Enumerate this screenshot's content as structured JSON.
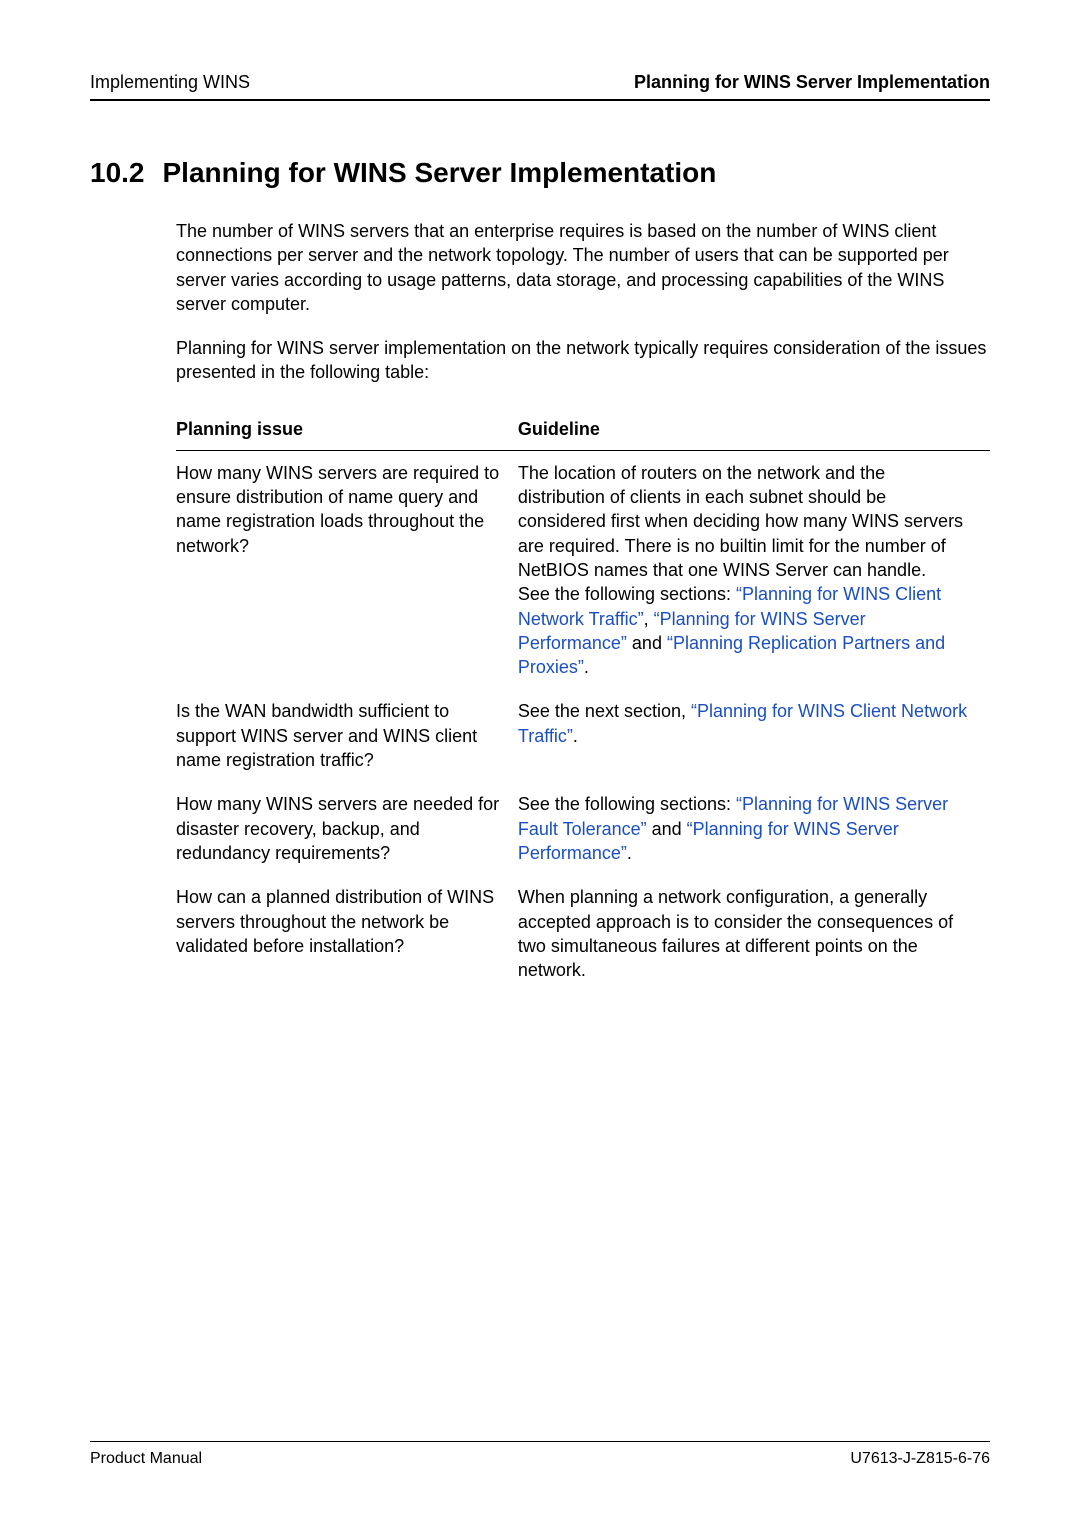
{
  "header": {
    "left": "Implementing WINS",
    "right": "Planning for WINS Server Implementation"
  },
  "section": {
    "number": "10.2",
    "title": "Planning for WINS Server Implementation"
  },
  "paragraphs": {
    "p1": "The number of WINS servers that an enterprise requires is based on the number of WINS client connections per server and the network topology. The number of users that can be supported per server varies according to usage patterns, data storage, and processing capabilities of the WINS server computer.",
    "p2": "Planning for WINS server implementation on the network typically requires consideration of the issues presented in the following table:"
  },
  "table": {
    "head_issue": "Planning issue",
    "head_guideline": "Guideline",
    "rows": [
      {
        "issue": "How many WINS servers are required to ensure distribution of name query and name registration loads throughout the network?",
        "g_pre": "The location of routers on the network and the distribution of clients in each subnet should be considered first when deciding how many WINS servers are required. There is no builtin limit for the number of NetBIOS names that one WINS Server can handle.",
        "g_see": "See the following sections: ",
        "l1": "“Planning for WINS Client Network Traffic”",
        "g_sep1": ", ",
        "l2": "“Planning for WINS Server Performance”",
        "g_sep2": " and ",
        "l3": "“Planning Replication Partners and Proxies”",
        "g_end": "."
      },
      {
        "issue": "Is the WAN bandwidth sufficient to support WINS server and WINS client name registration traffic?",
        "g_pre": "See the next section, ",
        "l1": "“Planning for WINS Client Network Traffic”",
        "g_end": "."
      },
      {
        "issue": "How many WINS servers are needed for disaster recovery, backup, and redundancy requirements?",
        "g_see": "See the following sections: ",
        "l1": "“Planning for WINS Server Fault Tolerance”",
        "g_sep1": " and ",
        "l2": "“Planning for WINS Server Performance”",
        "g_end": "."
      },
      {
        "issue": "How can a planned distribution of WINS servers throughout the network be validated before installation?",
        "g_plain": "When planning a network configuration, a generally accepted approach is to consider the consequences of two simultaneous failures at different points on the network."
      }
    ]
  },
  "footer": {
    "left": "Product Manual",
    "right": "U7613-J-Z815-6-76"
  }
}
